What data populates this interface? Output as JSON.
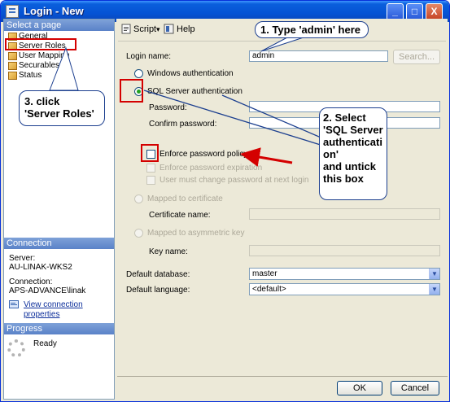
{
  "window": {
    "title": "Login - New",
    "minimize": "_",
    "maximize": "□",
    "close": "X"
  },
  "sidebar": {
    "select_page_header": "Select a page",
    "pages": [
      "General",
      "Server Roles",
      "User Mapping",
      "Securables",
      "Status"
    ],
    "connection_header": "Connection",
    "server_label": "Server:",
    "server_value": "AU-LINAK-WKS2",
    "connection_label": "Connection:",
    "connection_value": "APS-ADVANCE\\linak",
    "view_props_link": "View connection properties",
    "progress_header": "Progress",
    "progress_status": "Ready"
  },
  "toolbar": {
    "script_label": "Script",
    "script_arrow": "▾",
    "help_label": "Help"
  },
  "form": {
    "login_name_label": "Login name:",
    "login_name_value": "admin",
    "search_button": "Search...",
    "windows_auth": "Windows authentication",
    "sql_auth": "SQL Server authentication",
    "password_label": "Password:",
    "confirm_password_label": "Confirm password:",
    "enforce_policy": "Enforce password policy",
    "enforce_expiration": "Enforce password expiration",
    "must_change": "User must change password at next login",
    "mapped_cert": "Mapped to certificate",
    "cert_name_label": "Certificate name:",
    "mapped_asym": "Mapped to asymmetric key",
    "key_name_label": "Key name:",
    "default_db_label": "Default database:",
    "default_db_value": "master",
    "default_lang_label": "Default language:",
    "default_lang_value": "<default>"
  },
  "footer": {
    "ok": "OK",
    "cancel": "Cancel"
  },
  "annotations": {
    "callout_1": "1. Type 'admin' here",
    "callout_2_lines": [
      "2. Select",
      "'SQL Server",
      "authenticati",
      "on'",
      "and untick",
      "this box"
    ],
    "callout_3_lines": [
      "3. click",
      "'Server Roles'"
    ]
  },
  "icons": [
    "app-icon",
    "script-icon",
    "help-icon",
    "page-icon",
    "link-icon",
    "spinner-icon"
  ],
  "colors": {
    "titlebar": "#0553d4",
    "section_header": "#6b90d0",
    "annotation_red": "#d40000",
    "callout_border": "#1c3f8f"
  }
}
